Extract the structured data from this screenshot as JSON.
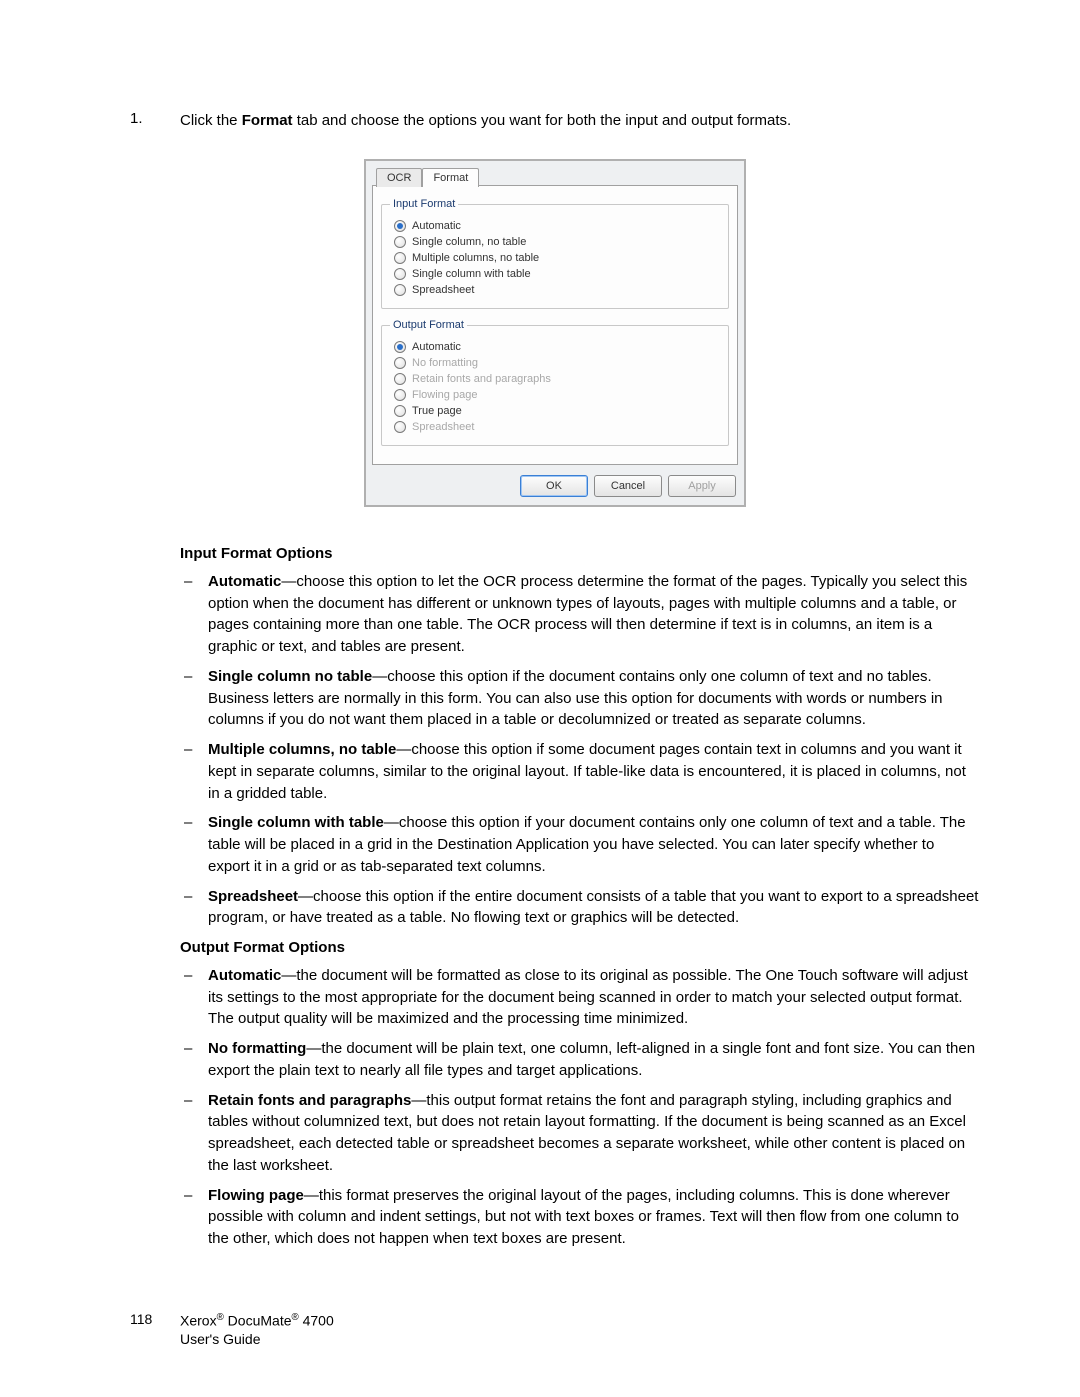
{
  "step": {
    "number": "1.",
    "prefix": "Click the ",
    "bold": "Format",
    "suffix": " tab and choose the options you want for both the input and output formats."
  },
  "dialog": {
    "tabs": {
      "ocr": "OCR",
      "format": "Format"
    },
    "input": {
      "legend": "Input Format",
      "opts": [
        {
          "label": "Automatic",
          "selected": true,
          "disabled": false
        },
        {
          "label": "Single column, no table",
          "selected": false,
          "disabled": false
        },
        {
          "label": "Multiple columns, no table",
          "selected": false,
          "disabled": false
        },
        {
          "label": "Single column with table",
          "selected": false,
          "disabled": false
        },
        {
          "label": "Spreadsheet",
          "selected": false,
          "disabled": false
        }
      ]
    },
    "output": {
      "legend": "Output Format",
      "opts": [
        {
          "label": "Automatic",
          "selected": true,
          "disabled": false
        },
        {
          "label": "No formatting",
          "selected": false,
          "disabled": true
        },
        {
          "label": "Retain fonts and paragraphs",
          "selected": false,
          "disabled": true
        },
        {
          "label": "Flowing page",
          "selected": false,
          "disabled": true
        },
        {
          "label": "True page",
          "selected": false,
          "disabled": false
        },
        {
          "label": "Spreadsheet",
          "selected": false,
          "disabled": true
        }
      ]
    },
    "buttons": {
      "ok": "OK",
      "cancel": "Cancel",
      "apply": "Apply"
    }
  },
  "headings": {
    "input": "Input Format Options",
    "output": "Output Format Options"
  },
  "inputItems": [
    {
      "bold": "Automatic",
      "text": "—choose this option to let the OCR process determine the format of the pages. Typically you select this option when the document has different or unknown types of layouts, pages with multiple columns and a table, or pages containing more than one table. The OCR process will then determine if text is in columns, an item is a graphic or text, and tables are present."
    },
    {
      "bold": "Single column no table",
      "text": "—choose this option if the document contains only one column of text and no tables. Business letters are normally in this form. You can also use this option for documents with words or numbers in columns if you do not want them placed in a table or decolumnized or treated as separate columns."
    },
    {
      "bold": "Multiple columns, no table",
      "text": "—choose this option if some document pages contain text in columns and you want it kept in separate columns, similar to the original layout. If table-like data is encountered, it is placed in columns, not in a gridded table."
    },
    {
      "bold": "Single column with table",
      "text": "—choose this option if your document contains only one column of text and a table. The table will be placed in a grid in the Destination Application you have selected. You can later specify whether to export it in a grid or as tab-separated text columns."
    },
    {
      "bold": "Spreadsheet",
      "text": "—choose this option if the entire document consists of a table that you want to export to a spreadsheet program, or have treated as a table. No flowing text or graphics will be detected."
    }
  ],
  "outputItems": [
    {
      "bold": "Automatic",
      "text": "—the document will be formatted as close to its original as possible. The One Touch software will adjust its settings to the most appropriate for the document being scanned in order to match your selected output format. The output quality will be maximized and the processing time minimized."
    },
    {
      "bold": "No formatting",
      "text": "—the document will be plain text, one column, left-aligned in a single font and font size. You can then export the plain text to nearly all file types and target applications."
    },
    {
      "bold": "Retain fonts and paragraphs",
      "text": "—this output format retains the font and paragraph styling, including graphics and tables without columnized text, but does not retain layout formatting. If the document is being scanned as an Excel spreadsheet, each detected table or spreadsheet becomes a separate worksheet, while other content is placed on the last worksheet."
    },
    {
      "bold": "Flowing page",
      "text": "—this format preserves the original layout of the pages, including columns. This is done wherever possible with column and indent settings, but not with text boxes or frames. Text will then flow from one column to the other, which does not happen when text boxes are present."
    }
  ],
  "footer": {
    "page": "118",
    "line1a": "Xerox",
    "line1b": " DocuMate",
    "line1c": " 4700",
    "reg": "®",
    "line2": "User's Guide"
  }
}
